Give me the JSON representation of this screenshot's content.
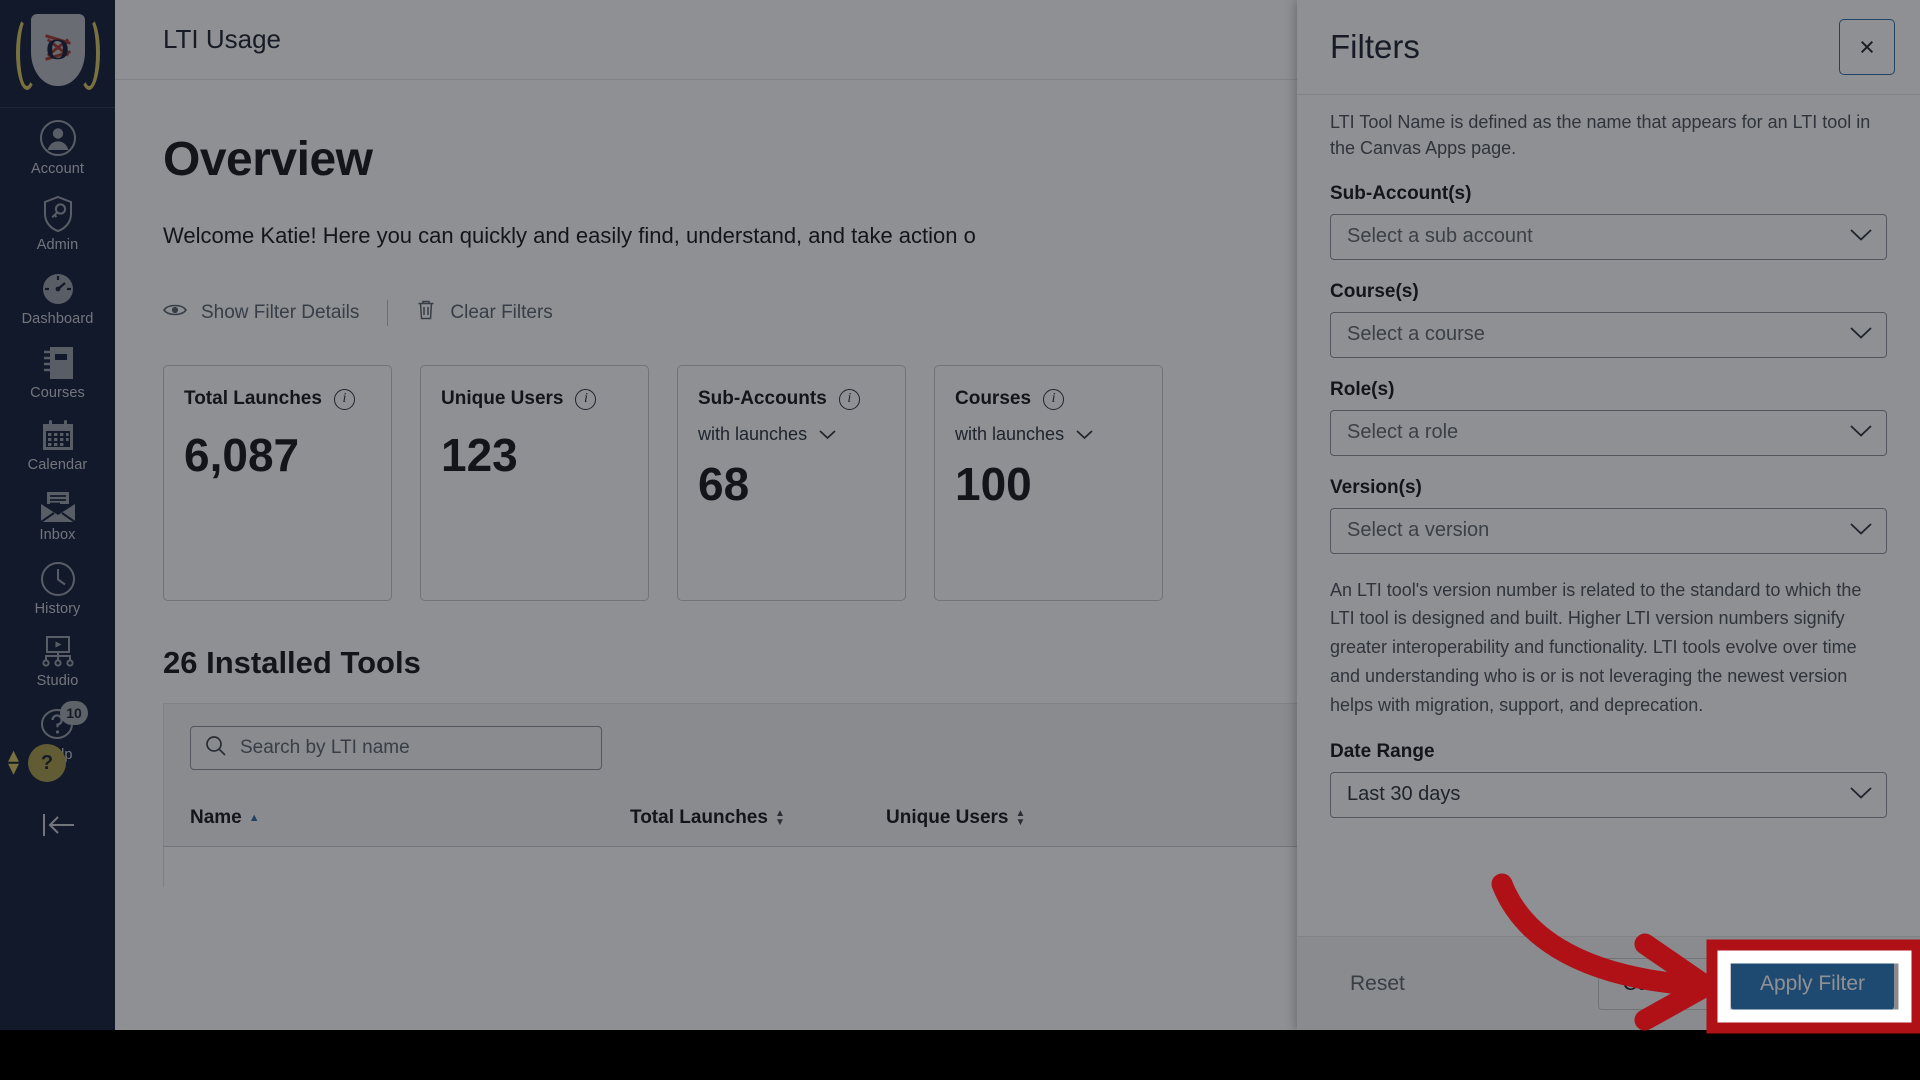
{
  "colors": {
    "nav_bg": "#131F3A",
    "accent_blue": "#2b7abd",
    "annotation_red": "#b01116",
    "scrim": "rgba(17,20,26,0.47)"
  },
  "globalnav": {
    "brand_letter": "O",
    "items": [
      {
        "label": "Account",
        "icon": "user-circle-icon"
      },
      {
        "label": "Admin",
        "icon": "shield-key-icon"
      },
      {
        "label": "Dashboard",
        "icon": "speedometer-icon"
      },
      {
        "label": "Courses",
        "icon": "notebook-icon"
      },
      {
        "label": "Calendar",
        "icon": "calendar-icon"
      },
      {
        "label": "Inbox",
        "icon": "envelope-icon"
      },
      {
        "label": "History",
        "icon": "clock-icon"
      },
      {
        "label": "Studio",
        "icon": "video-board-icon"
      },
      {
        "label": "Help",
        "icon": "question-bubble-icon",
        "badge": "10"
      }
    ],
    "collapse_icon": "collapse-left-icon"
  },
  "page": {
    "header_title": "LTI Usage",
    "heading": "Overview",
    "lede": "Welcome Katie! Here you can quickly and easily find, understand, and take action o",
    "show_filter_details": "Show Filter Details",
    "clear_filters": "Clear Filters",
    "cards": [
      {
        "name": "Total Launches",
        "sub": null,
        "value": "6,087"
      },
      {
        "name": "Unique Users",
        "sub": null,
        "value": "123"
      },
      {
        "name": "Sub-Accounts",
        "sub": "with launches",
        "value": "68"
      },
      {
        "name": "Courses",
        "sub": "with launches",
        "value": "100"
      }
    ],
    "tools_heading": "26 Installed Tools",
    "search_placeholder": "Search by LTI name",
    "table_headers": [
      {
        "label": "Name",
        "sort": "asc"
      },
      {
        "label": "Total Launches",
        "sort": "both"
      },
      {
        "label": "Unique Users",
        "sort": "both"
      }
    ]
  },
  "tray": {
    "title": "Filters",
    "close_label": "×",
    "help_text": "LTI Tool Name is defined as the name that appears for an LTI tool in the Canvas Apps page.",
    "fields": [
      {
        "label": "Sub-Account(s)",
        "value": "Select a sub account",
        "is_placeholder": true
      },
      {
        "label": "Course(s)",
        "value": "Select a course",
        "is_placeholder": true
      },
      {
        "label": "Role(s)",
        "value": "Select a role",
        "is_placeholder": true
      },
      {
        "label": "Version(s)",
        "value": "Select a version",
        "is_placeholder": true
      }
    ],
    "version_help": "An LTI tool's version number is related to the standard to which the LTI tool is designed and built. Higher LTI version numbers signify greater interoperability and functionality. LTI tools evolve over time and understanding who is or is not leveraging the newest version helps with migration, support, and deprecation.",
    "date_range_label": "Date Range",
    "date_range_value": "Last 30 days",
    "footer": {
      "reset": "Reset",
      "cancel": "Cancel",
      "apply": "Apply Filter"
    }
  },
  "annotation": {
    "type": "arrow-and-highlight",
    "target": "apply-filter-button",
    "color": "#b01116"
  }
}
